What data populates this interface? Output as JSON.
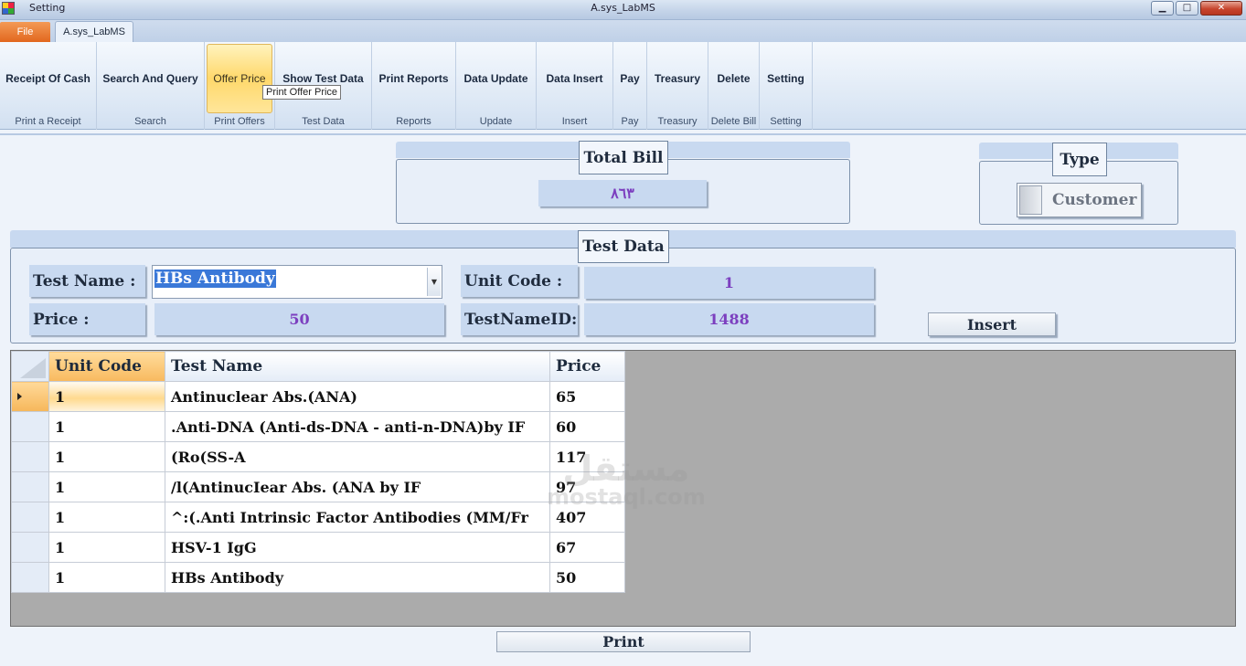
{
  "window": {
    "quick_access": "Setting",
    "title": "A.sys_LabMS",
    "min_glyph": "▁",
    "max_glyph": "□",
    "close_glyph": "✕"
  },
  "tabs": {
    "file": "File",
    "home": "A.sys_LabMS"
  },
  "ribbon": {
    "groups": [
      {
        "button": "Receipt Of Cash",
        "label": "Print a Receipt"
      },
      {
        "button": "Search And Query",
        "label": "Search"
      },
      {
        "button": "Offer Price",
        "label": "Print Offers"
      },
      {
        "button": "Show Test Data",
        "label": "Test Data"
      },
      {
        "button": "Print Reports",
        "label": "Reports"
      },
      {
        "button": "Data Update",
        "label": "Update"
      },
      {
        "button": "Data Insert",
        "label": "Insert"
      },
      {
        "button": "Pay",
        "label": "Pay"
      },
      {
        "button": "Treasury",
        "label": "Treasury"
      },
      {
        "button": "Delete",
        "label": "Delete Bill"
      },
      {
        "button": "Setting",
        "label": "Setting"
      }
    ],
    "tooltip": "Print Offer Price"
  },
  "total_bill": {
    "legend": "Total Bill",
    "value": "٨٦٣"
  },
  "type": {
    "legend": "Type",
    "option": "Customer"
  },
  "test_data": {
    "legend": "Test Data",
    "test_name_label": "Test Name :",
    "test_name_value": "HBs Antibody",
    "unit_code_label": "Unit Code :",
    "unit_code_value": "1",
    "price_label": "Price :",
    "price_value": "50",
    "test_name_id_label": "TestNameID:",
    "test_name_id_value": "1488",
    "insert_button": "Insert"
  },
  "grid": {
    "columns": [
      "Unit Code",
      "Test Name",
      "Price"
    ],
    "rows": [
      [
        "1",
        "Antinuclear Abs.(ANA)",
        "65"
      ],
      [
        "1",
        ".Anti-DNA (Anti-ds-DNA - anti-n-DNA)by IF",
        "60"
      ],
      [
        "1",
        "(Ro(SS-A",
        "117"
      ],
      [
        "1",
        "/l(AntinucIear Abs. (ANA by IF",
        "97"
      ],
      [
        "1",
        "^:(.Anti Intrinsic Factor Antibodies (MM/Fr",
        "407"
      ],
      [
        "1",
        "HSV-1 IgG",
        "67"
      ],
      [
        "1",
        "HBs Antibody",
        "50"
      ]
    ]
  },
  "print_button": "Print",
  "watermark": {
    "arabic": "مستقل",
    "latin": "mostaql.com"
  }
}
